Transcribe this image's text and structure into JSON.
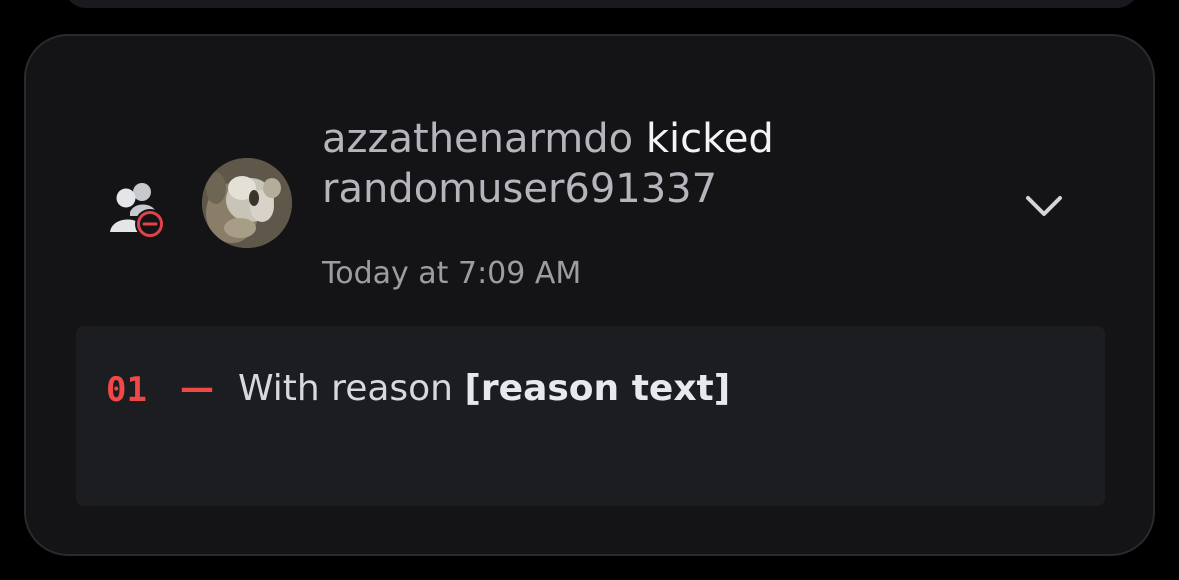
{
  "entry": {
    "actor": "azzathenarmdo",
    "action": "kicked",
    "target": "randomuser691337",
    "timestamp": "Today at 7:09 AM",
    "expanded": false
  },
  "icons": {
    "entry_type": "member-kick-icon",
    "expand": "chevron-down-icon"
  },
  "changes": [
    {
      "number": "01",
      "dash": "—",
      "prefix": "With reason ",
      "value": "[reason text]"
    }
  ],
  "colors": {
    "background": "#000000",
    "card": "#141417",
    "change_box": "#1c1d21",
    "change_number": "#f04747",
    "kick_badge": "#e0424a"
  }
}
